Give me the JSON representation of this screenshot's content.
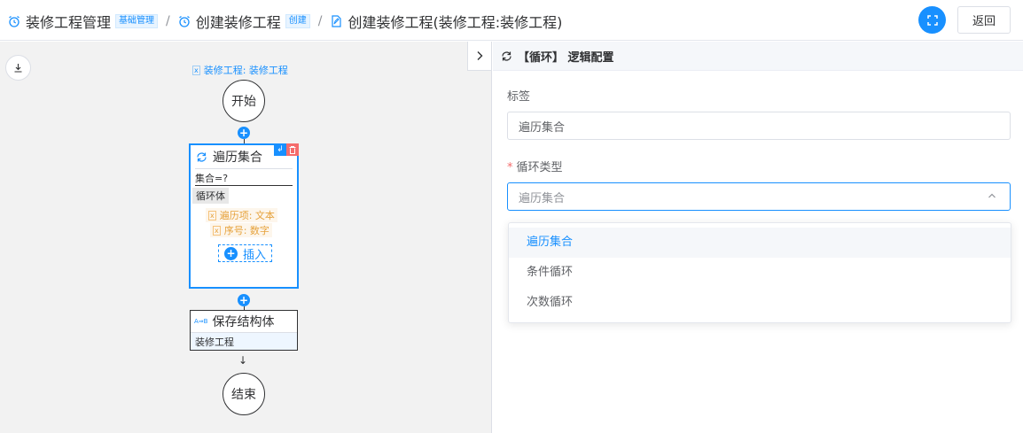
{
  "breadcrumb": [
    {
      "label": "装修工程管理",
      "tag": "基础管理"
    },
    {
      "label": "创建装修工程",
      "tag": "创建"
    },
    {
      "label": "创建装修工程(装修工程:装修工程)"
    }
  ],
  "header": {
    "back_label": "返回"
  },
  "flow": {
    "input_var": "装修工程: 装修工程",
    "start_label": "开始",
    "loop_node": {
      "title": "遍历集合",
      "condition": "集合=?",
      "body_label": "循环体",
      "vars": [
        "遍历项: 文本",
        "序号: 数字"
      ],
      "insert_label": "插入"
    },
    "save_node": {
      "icon_text": "A⇒B",
      "title": "保存结构体",
      "value": "装修工程"
    },
    "end_label": "结束"
  },
  "panel": {
    "title": "【循环】 逻辑配置",
    "label_field": {
      "label": "标签",
      "value": "遍历集合"
    },
    "type_field": {
      "required_mark": "*",
      "label": "循环类型",
      "placeholder": "遍历集合"
    },
    "options": [
      "遍历集合",
      "条件循环",
      "次数循环"
    ],
    "selected_index": 0
  },
  "colors": {
    "accent": "#1890ff",
    "danger": "#f56c6c",
    "warning": "#e6a23c"
  }
}
